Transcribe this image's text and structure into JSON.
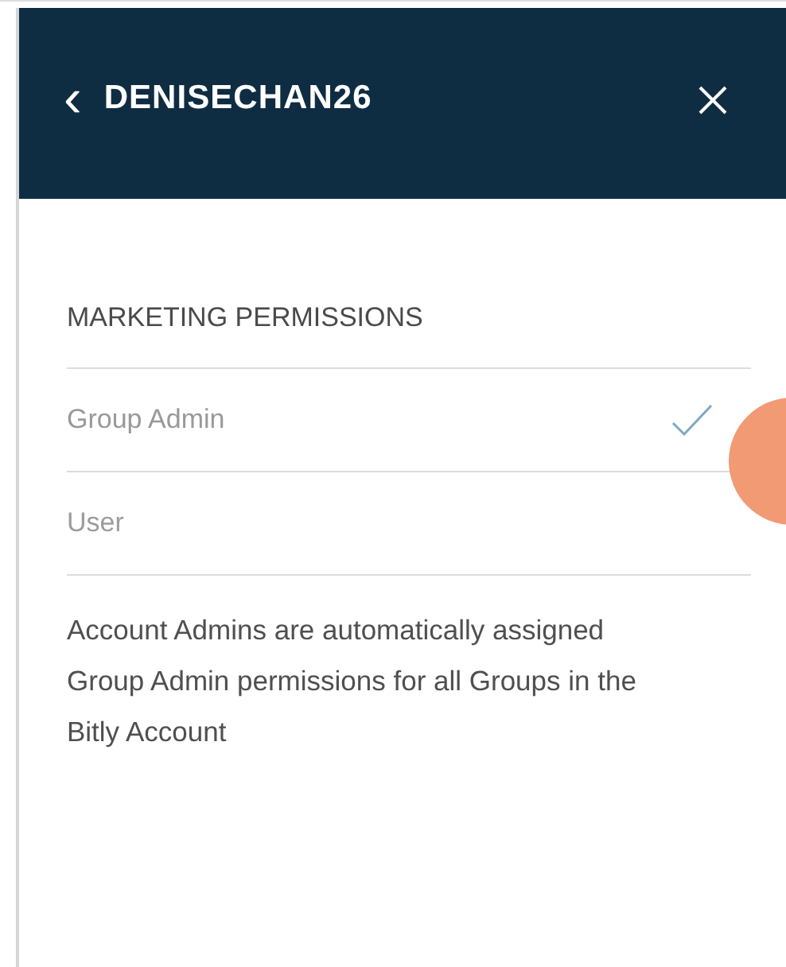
{
  "header": {
    "back_icon": "‹",
    "title": "DENISECHAN26"
  },
  "section": {
    "title": "MARKETING PERMISSIONS",
    "options": [
      {
        "label": "Group Admin",
        "selected": true
      },
      {
        "label": "User",
        "selected": false
      }
    ]
  },
  "note": "Account Admins are automatically assigned Group Admin permissions for all Groups in the Bitly Account"
}
